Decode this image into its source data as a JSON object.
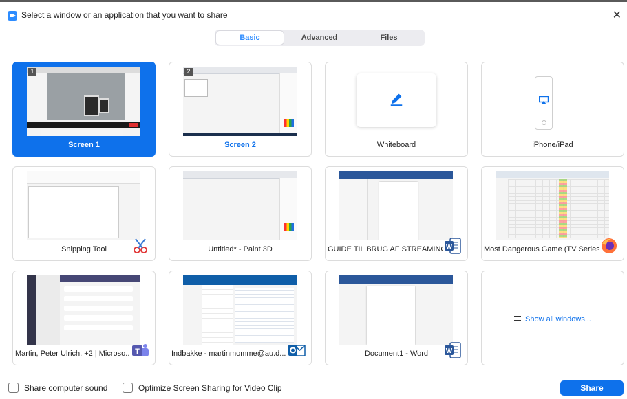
{
  "window": {
    "title": "Select a window or an application that you want to share",
    "close_glyph": "✕"
  },
  "tabs": [
    {
      "label": "Basic",
      "active": true
    },
    {
      "label": "Advanced",
      "active": false
    },
    {
      "label": "Files",
      "active": false
    }
  ],
  "tiles": [
    {
      "label": "Screen 1",
      "badge": "1",
      "selected": true
    },
    {
      "label": "Screen 2",
      "badge": "2",
      "selected": false
    },
    {
      "label": "Whiteboard",
      "icon": "pen-icon"
    },
    {
      "label": "iPhone/iPad",
      "icon": "airplay-icon"
    },
    {
      "label": "Snipping Tool",
      "app_icon": "snipping-tool-icon"
    },
    {
      "label": "Untitled* - Paint 3D"
    },
    {
      "label": "GUIDE TIL BRUG AF STREAMING ...",
      "app_icon": "word-icon"
    },
    {
      "label": "Most Dangerous Game (TV Series...",
      "app_icon": "firefox-icon"
    },
    {
      "label": "Martin, Peter Ulrich, +2 | Microso...",
      "app_icon": "teams-icon"
    },
    {
      "label": "Indbakke - martinmomme@au.d...",
      "app_icon": "outlook-icon"
    },
    {
      "label": "Document1 - Word",
      "app_icon": "word-icon"
    },
    {
      "label": "Show all windows...",
      "icon": "list-icon"
    }
  ],
  "footer": {
    "share_sound": "Share computer sound",
    "optimize_video": "Optimize Screen Sharing for Video Clip",
    "share_button": "Share"
  },
  "colors": {
    "accent": "#0e71eb",
    "word": "#2b579a",
    "teams": "#5558af",
    "outlook": "#0f5ea8",
    "firefox": "#ff7139"
  }
}
